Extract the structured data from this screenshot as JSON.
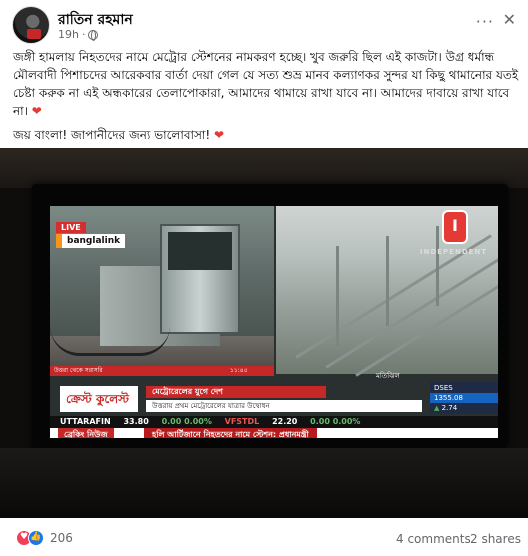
{
  "post": {
    "author": "রাতিন রহমান",
    "time": "19h",
    "more_label": "···",
    "close_label": "✕",
    "paragraphs": [
      "জঙ্গী হামলায় নিহতদের নামে মেট্রোর স্টেশনের নামকরণ হচ্ছে। খুব জরুরি ছিল এই কাজটা। উগ্র ধর্মান্ধ মৌলবাদী পিশাচদের আরেকবার বার্তা দেয়া গেল যে সত্য শুভ্র মানব কল্যাণকর সুন্দর যা কিছু থামানোর যতই চেষ্টা করুক না এই অন্ধকারের তেলাপোকারা, আমাদের থামায়ে রাখা যাবে না। আমাদের দাবায়ে রাখা যাবে না।",
      "জয় বাংলা! জাপানীদের জন্য ভালোবাসা!"
    ],
    "heart_glyph": "❤"
  },
  "tv": {
    "live_label": "LIVE",
    "sponsor": "banglalink",
    "channel_logo_letter": "I",
    "channel_name": "INDEPENDENT",
    "left_caption": "উত্তরা থেকে সরাসরি",
    "time_caption": "১১:৪৫",
    "right_caption": "মতিঝিল",
    "brand": "ক্রেস্ট কুলেস্ট",
    "headline_top": "মেট্রোরেলের যুগে দেশ",
    "headline_sub": "উত্তরায় প্রথম মেট্রোরেলের যাত্রার উদ্বোধন",
    "dses_label": "DSES",
    "dses_value": "1355.08",
    "dses_change": "2.74",
    "ticker": [
      {
        "symbol": "UTTARAFIN",
        "values": "33.80",
        "change": "0.00  0.00%"
      },
      {
        "symbol": "VFSTDL",
        "values": "22.20",
        "change": "0.00  0.00%"
      }
    ],
    "breaking_label": "ব্রেকিং নিউজ",
    "breaking_text": "হলি আর্টিজানে নিহতদের নামে স্টেশন: প্রধানমন্ত্রী"
  },
  "footer": {
    "reaction_count": "206",
    "comments": "4 comments",
    "shares": "2 shares"
  }
}
